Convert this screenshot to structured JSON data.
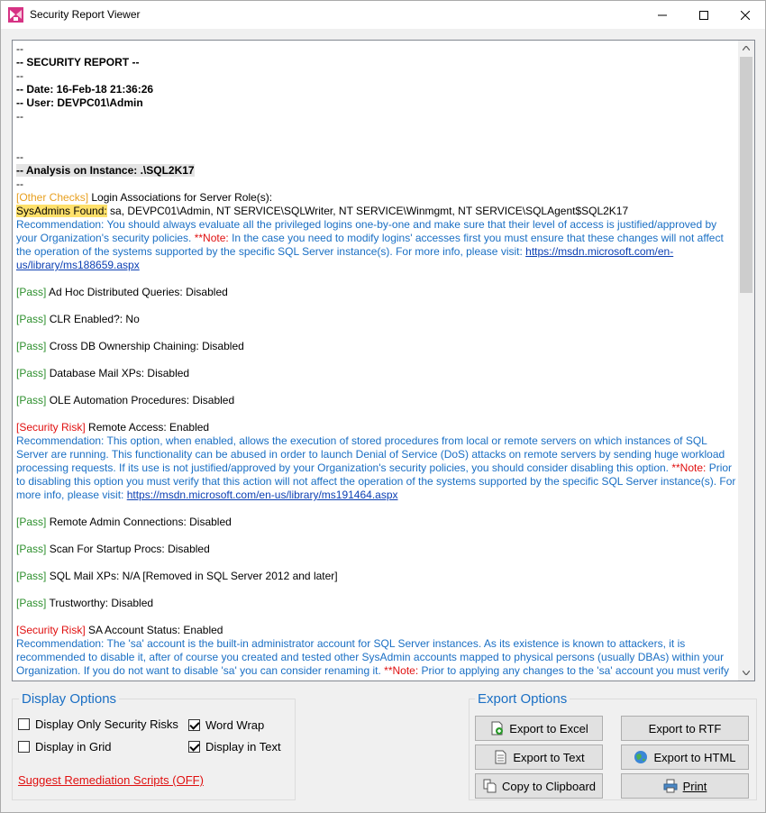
{
  "window": {
    "title": "Security Report Viewer"
  },
  "report": {
    "lines": [
      {
        "segments": [
          {
            "t": "--"
          }
        ]
      },
      {
        "segments": [
          {
            "t": "-- SECURITY REPORT --",
            "cls": "b"
          }
        ]
      },
      {
        "segments": [
          {
            "t": "--"
          }
        ]
      },
      {
        "segments": [
          {
            "t": "-- Date: 16-Feb-18 21:36:26",
            "cls": "b"
          }
        ]
      },
      {
        "segments": [
          {
            "t": "-- User: DEVPC01\\Admin",
            "cls": "b"
          }
        ]
      },
      {
        "segments": [
          {
            "t": "--"
          }
        ]
      },
      {
        "segments": [
          {
            "t": ""
          }
        ]
      },
      {
        "segments": [
          {
            "t": ""
          }
        ]
      },
      {
        "segments": [
          {
            "t": "--"
          }
        ]
      },
      {
        "segments": [
          {
            "t": "-- Analysis on Instance: .\\SQL2K17",
            "cls": "b hl"
          }
        ]
      },
      {
        "segments": [
          {
            "t": "--"
          }
        ]
      },
      {
        "segments": [
          {
            "t": "[Other Checks]",
            "cls": "orange"
          },
          {
            "t": " Login Associations for Server Role(s):"
          }
        ]
      },
      {
        "segments": [
          {
            "t": "SysAdmins Found:",
            "cls": "yellowbg"
          },
          {
            "t": " sa, DEVPC01\\Admin, NT SERVICE\\SQLWriter, NT SERVICE\\Winmgmt, NT SERVICE\\SQLAgent$SQL2K17"
          }
        ]
      },
      {
        "segments": [
          {
            "t": "Recommendation: You should always evaluate all the privileged logins one-by-one and make sure that their level of access is justified/approved by your Organization's security policies. ",
            "cls": "blue"
          },
          {
            "t": "**Note:",
            "cls": "rednote"
          },
          {
            "t": " In the case you need to modify logins' accesses first you must ensure that these changes will not affect the operation of the systems supported by the specific SQL Server instance(s). For more info, please visit: ",
            "cls": "blue"
          },
          {
            "t": "https://msdn.microsoft.com/en-us/library/ms188659.aspx",
            "cls": "link"
          }
        ]
      },
      {
        "segments": [
          {
            "t": ""
          }
        ]
      },
      {
        "segments": [
          {
            "t": "[Pass]",
            "cls": "green"
          },
          {
            "t": " Ad Hoc Distributed Queries: Disabled"
          }
        ]
      },
      {
        "segments": [
          {
            "t": ""
          }
        ]
      },
      {
        "segments": [
          {
            "t": "[Pass]",
            "cls": "green"
          },
          {
            "t": " CLR Enabled?: No"
          }
        ]
      },
      {
        "segments": [
          {
            "t": ""
          }
        ]
      },
      {
        "segments": [
          {
            "t": "[Pass]",
            "cls": "green"
          },
          {
            "t": " Cross DB Ownership Chaining: Disabled"
          }
        ]
      },
      {
        "segments": [
          {
            "t": ""
          }
        ]
      },
      {
        "segments": [
          {
            "t": "[Pass]",
            "cls": "green"
          },
          {
            "t": " Database Mail XPs: Disabled"
          }
        ]
      },
      {
        "segments": [
          {
            "t": ""
          }
        ]
      },
      {
        "segments": [
          {
            "t": "[Pass]",
            "cls": "green"
          },
          {
            "t": " OLE Automation Procedures: Disabled"
          }
        ]
      },
      {
        "segments": [
          {
            "t": ""
          }
        ]
      },
      {
        "segments": [
          {
            "t": "[Security Risk]",
            "cls": "red"
          },
          {
            "t": " Remote Access: Enabled"
          }
        ]
      },
      {
        "segments": [
          {
            "t": "Recommendation: This option, when enabled, allows the execution of stored procedures from local or remote servers on which instances of SQL Server are running. This functionality can be abused in order to launch Denial of Service (DoS) attacks on remote servers by sending huge workload processing requests. If its use is not justified/approved by your Organization's security policies, you should consider disabling this option. ",
            "cls": "blue"
          },
          {
            "t": "**Note:",
            "cls": "rednote"
          },
          {
            "t": " Prior to disabling this option you must verify that this action will not affect the operation of the systems supported by the specific SQL Server instance(s). For more info, please visit: ",
            "cls": "blue"
          },
          {
            "t": "https://msdn.microsoft.com/en-us/library/ms191464.aspx",
            "cls": "link"
          }
        ]
      },
      {
        "segments": [
          {
            "t": ""
          }
        ]
      },
      {
        "segments": [
          {
            "t": "[Pass]",
            "cls": "green"
          },
          {
            "t": " Remote Admin Connections: Disabled"
          }
        ]
      },
      {
        "segments": [
          {
            "t": ""
          }
        ]
      },
      {
        "segments": [
          {
            "t": "[Pass]",
            "cls": "green"
          },
          {
            "t": " Scan For Startup Procs: Disabled"
          }
        ]
      },
      {
        "segments": [
          {
            "t": ""
          }
        ]
      },
      {
        "segments": [
          {
            "t": "[Pass]",
            "cls": "green"
          },
          {
            "t": " SQL Mail XPs: N/A [Removed in SQL Server 2012 and later]"
          }
        ]
      },
      {
        "segments": [
          {
            "t": ""
          }
        ]
      },
      {
        "segments": [
          {
            "t": "[Pass]",
            "cls": "green"
          },
          {
            "t": " Trustworthy: Disabled"
          }
        ]
      },
      {
        "segments": [
          {
            "t": ""
          }
        ]
      },
      {
        "segments": [
          {
            "t": "[Security Risk]",
            "cls": "red"
          },
          {
            "t": " SA Account Status: Enabled"
          }
        ]
      },
      {
        "segments": [
          {
            "t": "Recommendation: The 'sa' account is the built-in administrator account for SQL Server instances. As its existence is known to attackers, it is recommended to disable it, after of course you created and tested other SysAdmin accounts mapped to physical persons (usually DBAs) within your Organization. If you do not want to disable 'sa' you can consider renaming it. ",
            "cls": "blue"
          },
          {
            "t": "**Note:",
            "cls": "rednote"
          },
          {
            "t": " Prior to applying any changes to the 'sa' account you must verify",
            "cls": "blue"
          }
        ]
      }
    ]
  },
  "display_options": {
    "title": "Display Options",
    "only_security_risks": {
      "label": "Display Only Security Risks",
      "checked": false
    },
    "display_in_grid": {
      "label": "Display in Grid",
      "checked": false
    },
    "word_wrap": {
      "label": "Word Wrap",
      "checked": true
    },
    "display_in_text": {
      "label": "Display in Text",
      "checked": true
    },
    "suggest_link": "Suggest Remediation Scripts (OFF)"
  },
  "export_options": {
    "title": "Export Options",
    "excel": "Export to Excel",
    "rtf": "Export to RTF",
    "text": "Export to Text",
    "html": "Export to HTML",
    "clipboard": "Copy to Clipboard",
    "print": "Print"
  },
  "colors": {
    "accent_blue": "#1a6fc4",
    "pass_green": "#2d8f2d",
    "risk_red": "#e01010",
    "other_orange": "#e8a020",
    "highlight_yellow": "#ffe16b"
  }
}
